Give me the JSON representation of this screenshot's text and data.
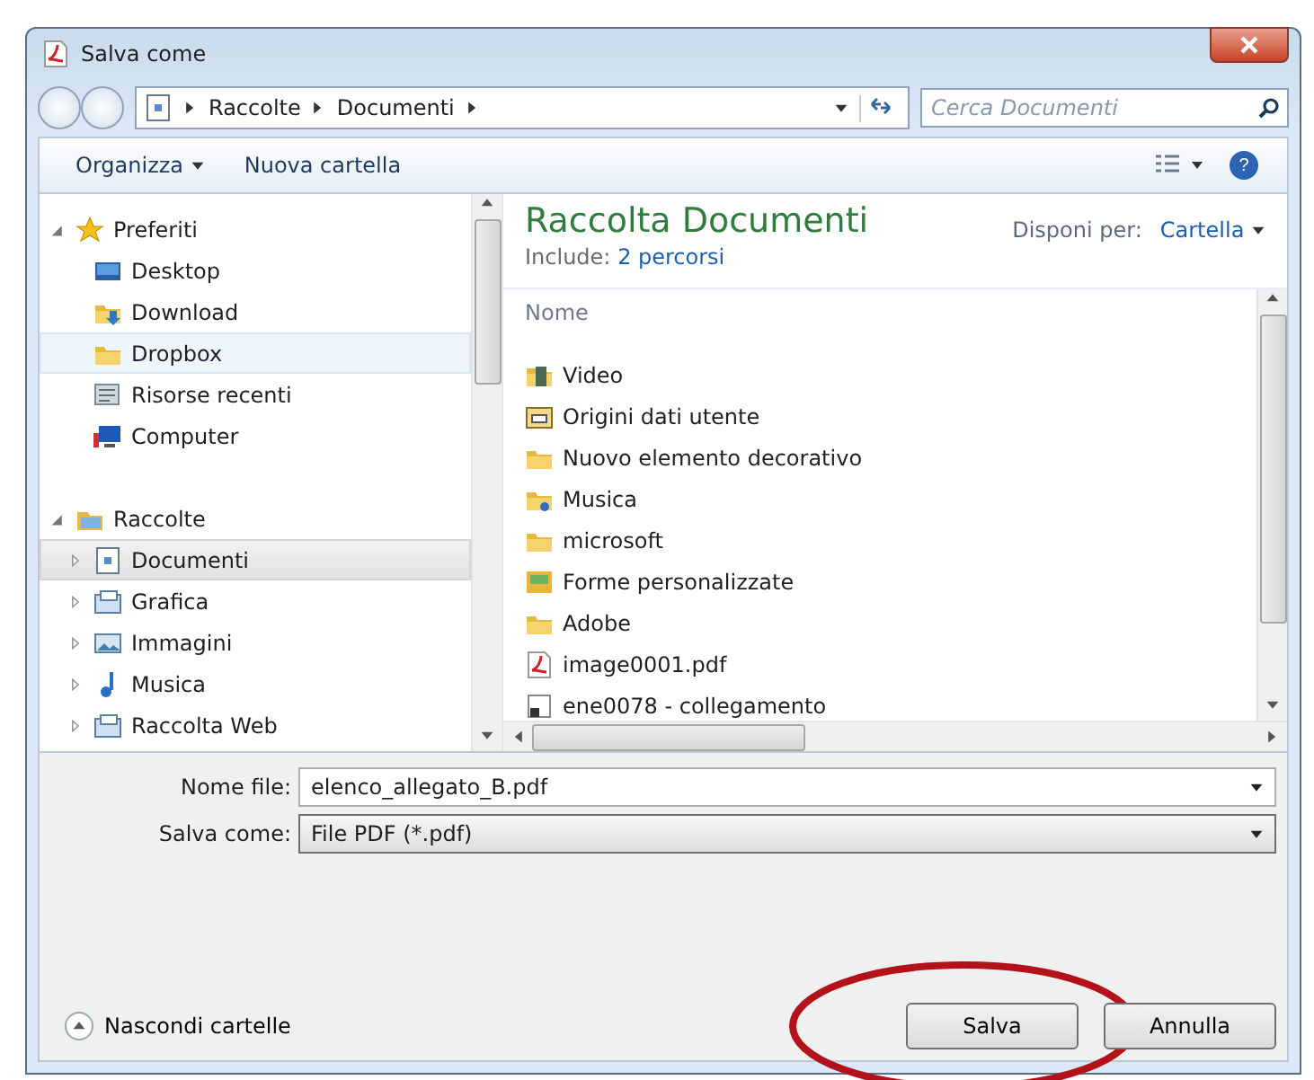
{
  "window": {
    "title": "Salva come"
  },
  "address": {
    "path": [
      "Raccolte",
      "Documenti"
    ]
  },
  "search": {
    "placeholder": "Cerca Documenti"
  },
  "toolbar": {
    "buttons": [
      {
        "label": "Organizza",
        "menu": true
      },
      {
        "label": "Nuova cartella",
        "menu": false
      }
    ],
    "help": "?"
  },
  "nav": [
    {
      "label": "Preferiti",
      "kind": "star",
      "expanded": true,
      "selected": false,
      "children": [
        {
          "label": "Desktop",
          "kind": "desktop",
          "selected": false,
          "hover": false
        },
        {
          "label": "Download",
          "kind": "download",
          "selected": false,
          "hover": false
        },
        {
          "label": "Dropbox",
          "kind": "folder",
          "selected": false,
          "hover": true
        },
        {
          "label": "Risorse recenti",
          "kind": "recent",
          "selected": false,
          "hover": false
        },
        {
          "label": "Computer",
          "kind": "computer",
          "selected": false,
          "hover": false
        }
      ]
    },
    {
      "label": "Raccolte",
      "kind": "library",
      "expanded": true,
      "selected": false,
      "children": [
        {
          "label": "Documenti",
          "kind": "documents",
          "selected": true,
          "hover": false
        },
        {
          "label": "Grafica",
          "kind": "librarybox",
          "selected": false,
          "hover": false
        },
        {
          "label": "Immagini",
          "kind": "pictures",
          "selected": false,
          "hover": false
        },
        {
          "label": "Musica",
          "kind": "music",
          "selected": false,
          "hover": false
        },
        {
          "label": "Raccolta Web",
          "kind": "librarybox",
          "selected": false,
          "hover": false
        }
      ]
    }
  ],
  "library": {
    "title": "Raccolta Documenti",
    "include_label": "Include:",
    "include_link": "2 percorsi",
    "arrange_label": "Disponi per:",
    "arrange_value": "Cartella"
  },
  "files": {
    "column": "Nome",
    "items": [
      {
        "name": "Video",
        "kind": "video"
      },
      {
        "name": "Origini dati utente",
        "kind": "datasource"
      },
      {
        "name": "Nuovo elemento decorativo",
        "kind": "folder"
      },
      {
        "name": "Musica",
        "kind": "musicfolder"
      },
      {
        "name": "microsoft",
        "kind": "folder"
      },
      {
        "name": "Forme personalizzate",
        "kind": "forms"
      },
      {
        "name": "Adobe",
        "kind": "folder"
      },
      {
        "name": "image0001.pdf",
        "kind": "pdf"
      },
      {
        "name": "ene0078 - collegamento",
        "kind": "shortcut"
      }
    ]
  },
  "form": {
    "fields": [
      {
        "label": "Nome file:",
        "value": "elenco_allegato_B.pdf",
        "kind": "input"
      },
      {
        "label": "Salva come:",
        "value": "File PDF (*.pdf)",
        "kind": "select"
      }
    ]
  },
  "footer": {
    "toggle": "Nascondi cartelle",
    "buttons": [
      {
        "label": "Salva",
        "highlighted": true
      },
      {
        "label": "Annulla",
        "highlighted": false
      }
    ]
  }
}
